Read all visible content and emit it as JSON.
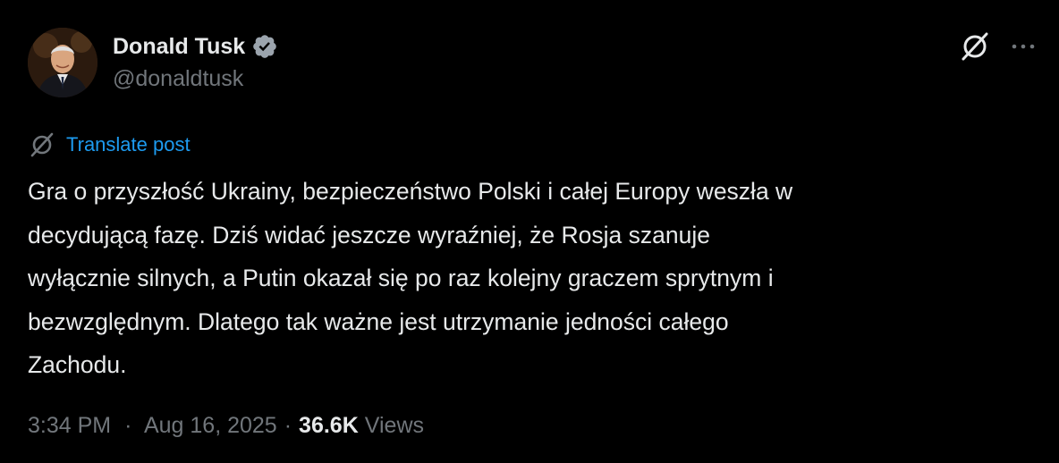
{
  "author": {
    "display_name": "Donald Tusk",
    "handle": "@donaldtusk",
    "verified": true
  },
  "header_actions": {
    "grok_icon": "grok-icon",
    "more_icon": "more-icon"
  },
  "translate": {
    "icon": "translate-icon",
    "label": "Translate post"
  },
  "post": {
    "lines": [
      "Gra o przyszłość Ukrainy, bezpieczeństwo Polski i całej Europy weszła w",
      "decydującą fazę. Dziś widać jeszcze wyraźniej, że Rosja szanuje",
      "wyłącznie silnych, a Putin okazał się po raz kolejny graczem sprytnym i",
      "bezwzględnym. Dlatego tak ważne jest utrzymanie jedności całego",
      "Zachodu."
    ]
  },
  "meta": {
    "time": "3:34 PM",
    "separator": "·",
    "date": "Aug 16, 2025",
    "views_count": "36.6K",
    "views_label": "Views"
  },
  "colors": {
    "background": "#000000",
    "text_primary": "#e7e9ea",
    "text_secondary": "#71767b",
    "accent": "#1d9bf0"
  }
}
